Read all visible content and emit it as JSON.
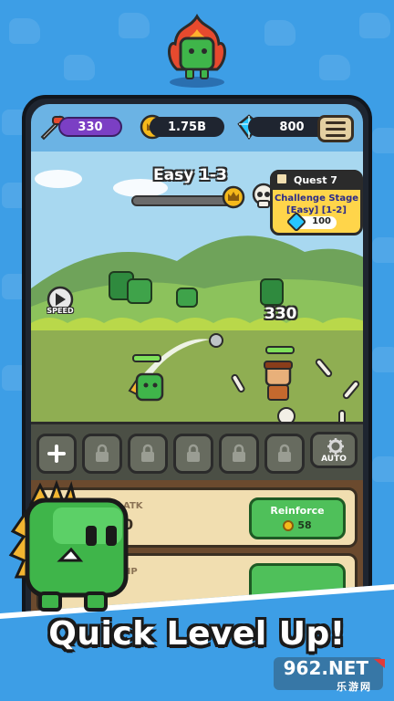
{
  "hud": {
    "power_value": "330",
    "gold_value": "1.75B",
    "gem_value": "800"
  },
  "stage": {
    "title": "Easy 1-3",
    "progress": 0.0
  },
  "quest": {
    "header": "Quest 7",
    "line1": "Challenge Stage",
    "line2": "[Easy] [1-2]",
    "reward": "100"
  },
  "speed_label": "SPEED",
  "damage_number": "330",
  "auto_label": "AUTO",
  "upgrades": [
    {
      "stat_label": "ATK",
      "stat_value": "0",
      "button_label": "Reinforce",
      "cost": "58"
    },
    {
      "stat_label": "HP",
      "stat_value": "",
      "button_label": "",
      "cost": ""
    }
  ],
  "banner": {
    "text": "Quick Level Up!"
  },
  "watermark": {
    "text": "962.NET",
    "sub": "乐游网"
  },
  "colors": {
    "background": "#3d9ee6",
    "power_pill": "#7b3fc4",
    "reinforce_button": "#4fc05a",
    "quest_card": "#ffd54a"
  }
}
